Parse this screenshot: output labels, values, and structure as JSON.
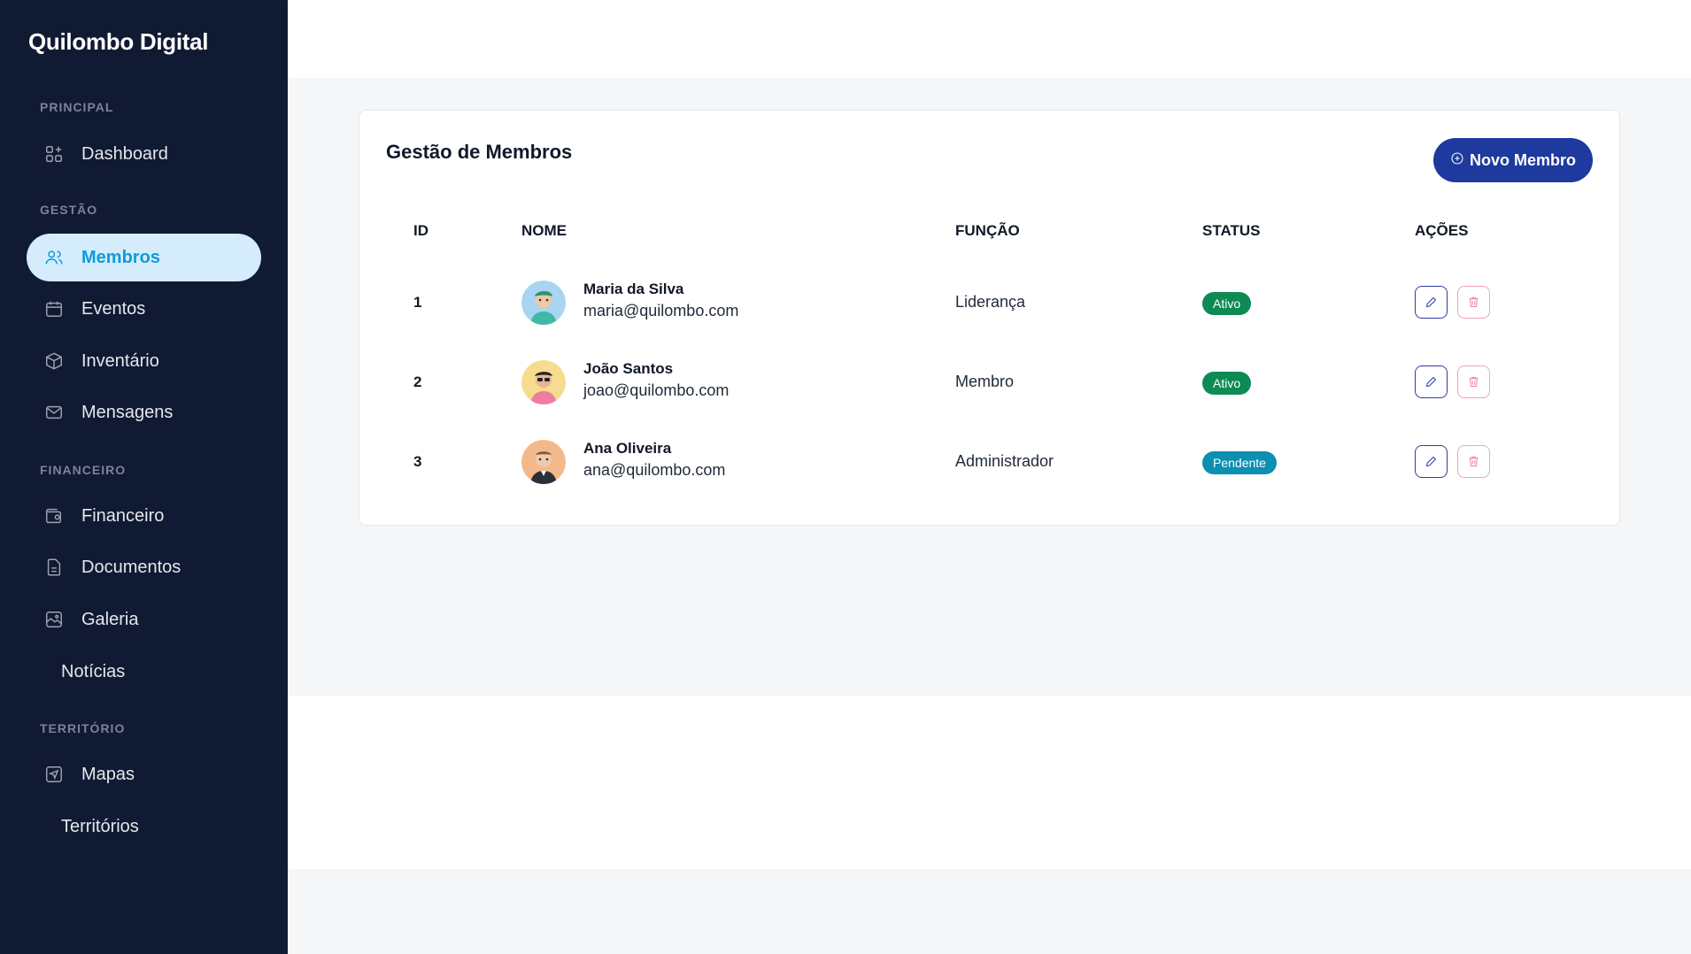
{
  "sidebar": {
    "brand": "Quilombo Digital",
    "sections": {
      "principal": "PRINCIPAL",
      "gestao": "GESTÃO",
      "financeiro": "FINANCEIRO",
      "territorio": "TERRITÓRIO"
    },
    "items": {
      "dashboard": "Dashboard",
      "membros": "Membros",
      "eventos": "Eventos",
      "inventario": "Inventário",
      "mensagens": "Mensagens",
      "financeiro": "Financeiro",
      "documentos": "Documentos",
      "galeria": "Galeria",
      "noticias": "Notícias",
      "mapas": "Mapas",
      "territorios": "Territórios"
    },
    "active_item": "Membros"
  },
  "card": {
    "title": "Gestão de Membros",
    "new_button_label": "Novo Membro"
  },
  "table": {
    "headers": {
      "id": "ID",
      "nome": "NOME",
      "funcao": "FUNÇÃO",
      "status": "STATUS",
      "acoes": "AÇÕES"
    },
    "rows": [
      {
        "id": "1",
        "name": "Maria da Silva",
        "email": "maria@quilombo.com",
        "role": "Liderança",
        "status": "Ativo"
      },
      {
        "id": "2",
        "name": "João Santos",
        "email": "joao@quilombo.com",
        "role": "Membro",
        "status": "Ativo"
      },
      {
        "id": "3",
        "name": "Ana Oliveira",
        "email": "ana@quilombo.com",
        "role": "Administrador",
        "status": "Pendente"
      }
    ]
  },
  "colors": {
    "sidebar_bg": "#111a33",
    "active_bg": "#d4ecfc",
    "active_text": "#0e9bd8",
    "primary_button": "#1e3a9e",
    "status_ativo": "#0e8a55",
    "status_pendente": "#0c8fb0",
    "delete_accent": "#f07c98"
  },
  "icons": {
    "dashboard": "dashboard-grid-icon",
    "membros": "users-icon",
    "eventos": "calendar-icon",
    "inventario": "box-icon",
    "mensagens": "mail-icon",
    "financeiro": "wallet-icon",
    "documentos": "document-icon",
    "galeria": "image-icon",
    "mapas": "map-pin-icon",
    "new_member": "plus-circle-icon",
    "edit": "pencil-icon",
    "delete": "trash-icon"
  }
}
